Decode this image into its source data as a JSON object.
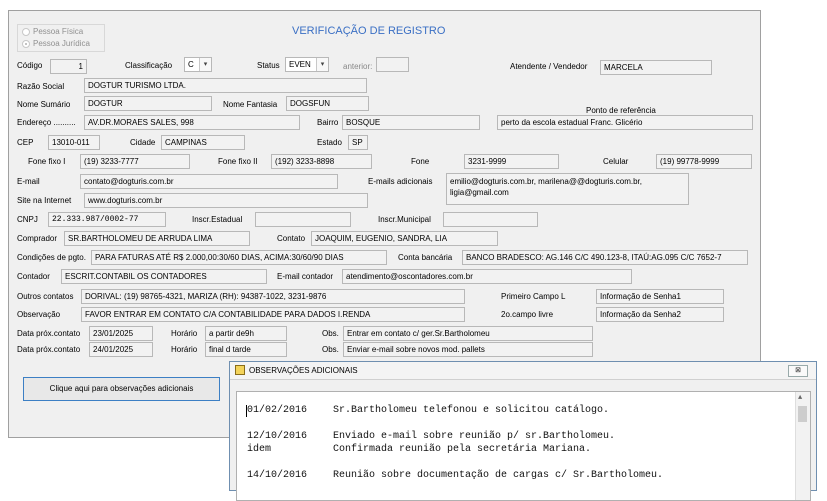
{
  "form": {
    "title": "VERIFICAÇÃO DE REGISTRO",
    "radio_fisica": "Pessoa Física",
    "radio_juridica": "Pessoa Jurídica",
    "codigo_label": "Código",
    "codigo": "1",
    "classificacao_label": "Classificação",
    "classificacao": "C",
    "status_label": "Status",
    "status": "EVEN",
    "anterior_label": "anterior:",
    "anterior": "",
    "atendente_label": "Atendente / Vendedor",
    "atendente": "MARCELA",
    "razao_label": "Razão Social",
    "razao": "DOGTUR TURISMO LTDA.",
    "nome_sumario_label": "Nome Sumário",
    "nome_sumario": "DOGTUR",
    "nome_fantasia_label": "Nome Fantasia",
    "nome_fantasia": "DOGSFUN",
    "ponto_ref_label": "Ponto de referência",
    "ponto_ref": "perto da escola estadual Franc. Glicério",
    "endereco_label": "Endereço ..........",
    "endereco": "AV.DR.MORAES SALES, 998",
    "bairro_label": "Bairro",
    "bairro": "BOSQUE",
    "cep_label": "CEP",
    "cep": "13010-011",
    "cidade_label": "Cidade",
    "cidade": "CAMPINAS",
    "estado_label": "Estado",
    "estado": "SP",
    "fone1_label": "Fone fixo I",
    "fone1": "(19) 3233-7777",
    "fone2_label": "Fone fixo II",
    "fone2": "(192) 3233-8898",
    "fone_label": "Fone",
    "fone": "3231-9999",
    "celular_label": "Celular",
    "celular": "(19) 99778-9999",
    "email_label": "E-mail",
    "email": "contato@dogturis.com.br",
    "emails_ad_label": "E-mails adicionais",
    "emails_ad_line1": "emilio@dogturis.com.br, marilena@@dogturis.com.br,",
    "emails_ad_line2": "ligia@gmail.com",
    "site_label": "Site na Internet",
    "site": "www.dogturis.com.br",
    "cnpj_label": "CNPJ",
    "cnpj": "22.333.987/0002-77",
    "inscr_est_label": "Inscr.Estadual",
    "inscr_est": "",
    "inscr_mun_label": "Inscr.Municipal",
    "inscr_mun": "",
    "comprador_label": "Comprador",
    "comprador": "SR.BARTHOLOMEU DE ARRUDA LIMA",
    "contato_label": "Contato",
    "contato": "JOAQUIM, EUGENIO, SANDRA, LIA",
    "condicoes_label": "Condições de pgto.",
    "condicoes": "PARA FATURAS ATÉ R$ 2.000,00:30/60 DIAS, ACIMA:30/60/90 DIAS",
    "conta_label": "Conta bancária",
    "conta": "BANCO BRADESCO: AG.146 C/C 490.123-8, ITAÚ:AG.095 C/C 7652-7",
    "contador_label": "Contador",
    "contador": "ESCRIT.CONTABIL OS CONTADORES",
    "email_contador_label": "E-mail contador",
    "email_contador": "atendimento@oscontadores.com.br",
    "outros_label": "Outros contatos",
    "outros": "DORIVAL: (19) 98765-4321, MARIZA (RH): 94387-1022, 3231-9876",
    "primeiro_campo_label": "Primeiro Campo L",
    "primeiro_campo": "Informação de Senha1",
    "observacao_label": "Observação",
    "observacao": "FAVOR ENTRAR EM CONTATO C/A CONTABILIDADE PARA DADOS I.RENDA",
    "segundo_campo_label": "2o.campo livre",
    "segundo_campo": "Informação da Senha2",
    "data_prox_label": "Data próx.contato",
    "data1": "23/01/2025",
    "data2": "24/01/2025",
    "horario_label": "Horário",
    "horario1": "a partir de9h",
    "horario2": "final d tarde",
    "obs_label": "Obs.",
    "obs1": "Entrar em contato c/ ger.Sr.Bartholomeu",
    "obs2": "Enviar e-mail sobre novos mod. pallets",
    "obs_button": "Clique aqui para observações adicionais"
  },
  "dialog": {
    "title": "OBSERVAÇÕES ADICIONAIS",
    "close": "⊠",
    "entries": [
      {
        "date": "01/02/2016",
        "text": "Sr.Bartholomeu telefonou e solicitou catálogo."
      },
      {
        "date": "12/10/2016",
        "text": "Enviado e-mail sobre reunião p/ sr.Bartholomeu."
      },
      {
        "date": "idem",
        "text": "Confirmada reunião pela secretária Mariana."
      },
      {
        "date": "14/10/2016",
        "text": "Reunião sobre documentação de cargas c/ Sr.Bartholomeu."
      }
    ]
  },
  "colors": {
    "title": "#3a6fc4",
    "button_border": "#3c7fc4"
  }
}
